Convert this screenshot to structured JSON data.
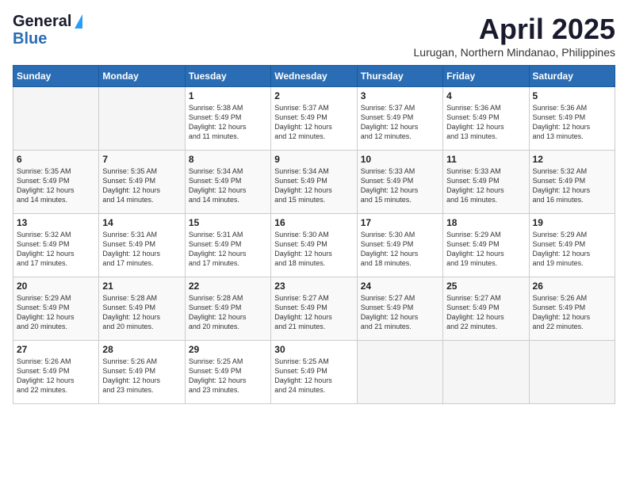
{
  "logo": {
    "general": "General",
    "blue": "Blue"
  },
  "title": "April 2025",
  "location": "Lurugan, Northern Mindanao, Philippines",
  "weekdays": [
    "Sunday",
    "Monday",
    "Tuesday",
    "Wednesday",
    "Thursday",
    "Friday",
    "Saturday"
  ],
  "weeks": [
    [
      {
        "day": "",
        "info": ""
      },
      {
        "day": "",
        "info": ""
      },
      {
        "day": "1",
        "info": "Sunrise: 5:38 AM\nSunset: 5:49 PM\nDaylight: 12 hours\nand 11 minutes."
      },
      {
        "day": "2",
        "info": "Sunrise: 5:37 AM\nSunset: 5:49 PM\nDaylight: 12 hours\nand 12 minutes."
      },
      {
        "day": "3",
        "info": "Sunrise: 5:37 AM\nSunset: 5:49 PM\nDaylight: 12 hours\nand 12 minutes."
      },
      {
        "day": "4",
        "info": "Sunrise: 5:36 AM\nSunset: 5:49 PM\nDaylight: 12 hours\nand 13 minutes."
      },
      {
        "day": "5",
        "info": "Sunrise: 5:36 AM\nSunset: 5:49 PM\nDaylight: 12 hours\nand 13 minutes."
      }
    ],
    [
      {
        "day": "6",
        "info": "Sunrise: 5:35 AM\nSunset: 5:49 PM\nDaylight: 12 hours\nand 14 minutes."
      },
      {
        "day": "7",
        "info": "Sunrise: 5:35 AM\nSunset: 5:49 PM\nDaylight: 12 hours\nand 14 minutes."
      },
      {
        "day": "8",
        "info": "Sunrise: 5:34 AM\nSunset: 5:49 PM\nDaylight: 12 hours\nand 14 minutes."
      },
      {
        "day": "9",
        "info": "Sunrise: 5:34 AM\nSunset: 5:49 PM\nDaylight: 12 hours\nand 15 minutes."
      },
      {
        "day": "10",
        "info": "Sunrise: 5:33 AM\nSunset: 5:49 PM\nDaylight: 12 hours\nand 15 minutes."
      },
      {
        "day": "11",
        "info": "Sunrise: 5:33 AM\nSunset: 5:49 PM\nDaylight: 12 hours\nand 16 minutes."
      },
      {
        "day": "12",
        "info": "Sunrise: 5:32 AM\nSunset: 5:49 PM\nDaylight: 12 hours\nand 16 minutes."
      }
    ],
    [
      {
        "day": "13",
        "info": "Sunrise: 5:32 AM\nSunset: 5:49 PM\nDaylight: 12 hours\nand 17 minutes."
      },
      {
        "day": "14",
        "info": "Sunrise: 5:31 AM\nSunset: 5:49 PM\nDaylight: 12 hours\nand 17 minutes."
      },
      {
        "day": "15",
        "info": "Sunrise: 5:31 AM\nSunset: 5:49 PM\nDaylight: 12 hours\nand 17 minutes."
      },
      {
        "day": "16",
        "info": "Sunrise: 5:30 AM\nSunset: 5:49 PM\nDaylight: 12 hours\nand 18 minutes."
      },
      {
        "day": "17",
        "info": "Sunrise: 5:30 AM\nSunset: 5:49 PM\nDaylight: 12 hours\nand 18 minutes."
      },
      {
        "day": "18",
        "info": "Sunrise: 5:29 AM\nSunset: 5:49 PM\nDaylight: 12 hours\nand 19 minutes."
      },
      {
        "day": "19",
        "info": "Sunrise: 5:29 AM\nSunset: 5:49 PM\nDaylight: 12 hours\nand 19 minutes."
      }
    ],
    [
      {
        "day": "20",
        "info": "Sunrise: 5:29 AM\nSunset: 5:49 PM\nDaylight: 12 hours\nand 20 minutes."
      },
      {
        "day": "21",
        "info": "Sunrise: 5:28 AM\nSunset: 5:49 PM\nDaylight: 12 hours\nand 20 minutes."
      },
      {
        "day": "22",
        "info": "Sunrise: 5:28 AM\nSunset: 5:49 PM\nDaylight: 12 hours\nand 20 minutes."
      },
      {
        "day": "23",
        "info": "Sunrise: 5:27 AM\nSunset: 5:49 PM\nDaylight: 12 hours\nand 21 minutes."
      },
      {
        "day": "24",
        "info": "Sunrise: 5:27 AM\nSunset: 5:49 PM\nDaylight: 12 hours\nand 21 minutes."
      },
      {
        "day": "25",
        "info": "Sunrise: 5:27 AM\nSunset: 5:49 PM\nDaylight: 12 hours\nand 22 minutes."
      },
      {
        "day": "26",
        "info": "Sunrise: 5:26 AM\nSunset: 5:49 PM\nDaylight: 12 hours\nand 22 minutes."
      }
    ],
    [
      {
        "day": "27",
        "info": "Sunrise: 5:26 AM\nSunset: 5:49 PM\nDaylight: 12 hours\nand 22 minutes."
      },
      {
        "day": "28",
        "info": "Sunrise: 5:26 AM\nSunset: 5:49 PM\nDaylight: 12 hours\nand 23 minutes."
      },
      {
        "day": "29",
        "info": "Sunrise: 5:25 AM\nSunset: 5:49 PM\nDaylight: 12 hours\nand 23 minutes."
      },
      {
        "day": "30",
        "info": "Sunrise: 5:25 AM\nSunset: 5:49 PM\nDaylight: 12 hours\nand 24 minutes."
      },
      {
        "day": "",
        "info": ""
      },
      {
        "day": "",
        "info": ""
      },
      {
        "day": "",
        "info": ""
      }
    ]
  ]
}
